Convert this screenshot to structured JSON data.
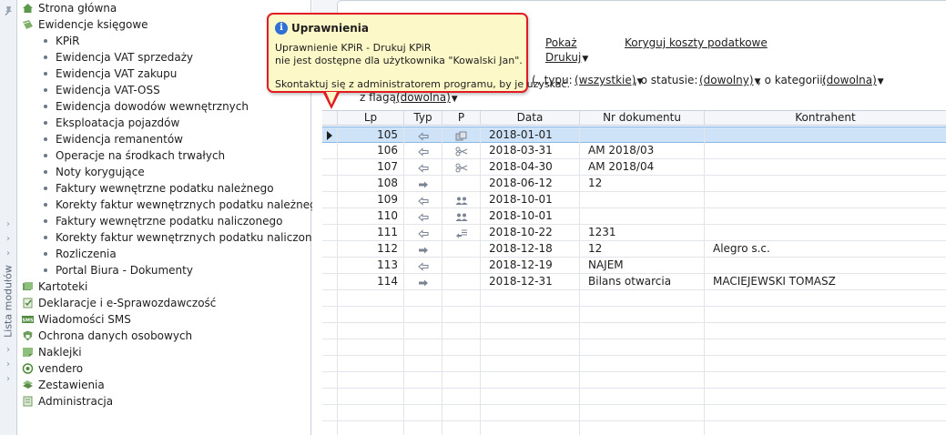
{
  "strip": {
    "label": "Lista modułów"
  },
  "nav": {
    "items": [
      {
        "label": "Strona główna",
        "icon": "home-icon",
        "sub": false
      },
      {
        "label": "Ewidencje księgowe",
        "icon": "ledger-icon",
        "sub": false
      },
      {
        "label": "KPiR",
        "sub": true
      },
      {
        "label": "Ewidencja VAT sprzedaży",
        "sub": true
      },
      {
        "label": "Ewidencja VAT zakupu",
        "sub": true
      },
      {
        "label": "Ewidencja VAT-OSS",
        "sub": true
      },
      {
        "label": "Ewidencja dowodów wewnętrznych",
        "sub": true
      },
      {
        "label": "Eksploatacja pojazdów",
        "sub": true
      },
      {
        "label": "Ewidencja remanentów",
        "sub": true
      },
      {
        "label": "Operacje na środkach trwałych",
        "sub": true
      },
      {
        "label": "Noty korygujące",
        "sub": true
      },
      {
        "label": "Faktury wewnętrzne podatku należnego",
        "sub": true
      },
      {
        "label": "Korekty faktur wewnętrznych podatku należnego",
        "sub": true
      },
      {
        "label": "Faktury wewnętrzne podatku naliczonego",
        "sub": true
      },
      {
        "label": "Korekty faktur wewnętrznych podatku naliczonego",
        "sub": true
      },
      {
        "label": "Rozliczenia",
        "sub": true
      },
      {
        "label": "Portal Biura - Dokumenty",
        "sub": true
      },
      {
        "label": "Kartoteki",
        "icon": "cards-icon",
        "sub": false
      },
      {
        "label": "Deklaracje i e-Sprawozdawczość",
        "icon": "declaration-icon",
        "sub": false
      },
      {
        "label": "Wiadomości SMS",
        "icon": "sms-icon",
        "sub": false
      },
      {
        "label": "Ochrona danych osobowych",
        "icon": "shield-icon",
        "sub": false
      },
      {
        "label": "Naklejki",
        "icon": "sticker-icon",
        "sub": false
      },
      {
        "label": "vendero",
        "icon": "vendero-icon",
        "sub": false
      },
      {
        "label": "Zestawienia",
        "icon": "report-icon",
        "sub": false
      },
      {
        "label": "Administracja",
        "icon": "admin-icon",
        "sub": false
      }
    ]
  },
  "toolbar": {
    "show_label": "Pokaż",
    "print_label": "Drukuj",
    "correct_costs_label": "Koryguj koszty podatkowe"
  },
  "filters": {
    "type_prefix": ", typu:",
    "type_value": "(wszystkie)",
    "status_prefix": ", o statusie:",
    "status_value": "(dowolny)",
    "category_prefix": ", o kategorii:",
    "category_value": "(dowolna)",
    "flag_prefix": "z flagą:",
    "flag_value": "(dowolna)"
  },
  "grid": {
    "columns": [
      "Lp",
      "Typ",
      "P",
      "Data",
      "Nr dokumentu",
      "Kontrahent"
    ],
    "rows": [
      {
        "lp": "105",
        "typ": "in",
        "p": "doc",
        "data": "2018-01-01",
        "nr": "",
        "kontrahent": "",
        "selected": true
      },
      {
        "lp": "106",
        "typ": "in",
        "p": "cut",
        "data": "2018-03-31",
        "nr": "AM 2018/03",
        "kontrahent": ""
      },
      {
        "lp": "107",
        "typ": "in",
        "p": "cut",
        "data": "2018-04-30",
        "nr": "AM 2018/04",
        "kontrahent": ""
      },
      {
        "lp": "108",
        "typ": "out",
        "p": "",
        "data": "2018-06-12",
        "nr": "12",
        "kontrahent": ""
      },
      {
        "lp": "109",
        "typ": "in",
        "p": "people",
        "data": "2018-10-01",
        "nr": "",
        "kontrahent": ""
      },
      {
        "lp": "110",
        "typ": "in",
        "p": "people",
        "data": "2018-10-01",
        "nr": "",
        "kontrahent": ""
      },
      {
        "lp": "111",
        "typ": "in",
        "p": "list",
        "data": "2018-10-22",
        "nr": "1231",
        "kontrahent": ""
      },
      {
        "lp": "112",
        "typ": "out",
        "p": "",
        "data": "2018-12-18",
        "nr": "12",
        "kontrahent": "Alegro s.c."
      },
      {
        "lp": "113",
        "typ": "in",
        "p": "",
        "data": "2018-12-19",
        "nr": "NAJEM",
        "kontrahent": ""
      },
      {
        "lp": "114",
        "typ": "out",
        "p": "",
        "data": "2018-12-31",
        "nr": "Bilans otwarcia",
        "kontrahent": "MACIEJEWSKI TOMASZ"
      }
    ]
  },
  "tooltip": {
    "title": "Uprawnienia",
    "line1": "Uprawnienie KPiR - Drukuj KPiR",
    "line2": "nie jest dostępne dla użytkownika \"Kowalski Jan\".",
    "line3": "Skontaktuj się z administratorem programu, by je uzyskać."
  },
  "colors": {
    "selection": "#cfe3f8",
    "tooltip_bg": "#fdf8c8",
    "tooltip_border": "#e21c24",
    "info_blue": "#2f6fd6"
  }
}
